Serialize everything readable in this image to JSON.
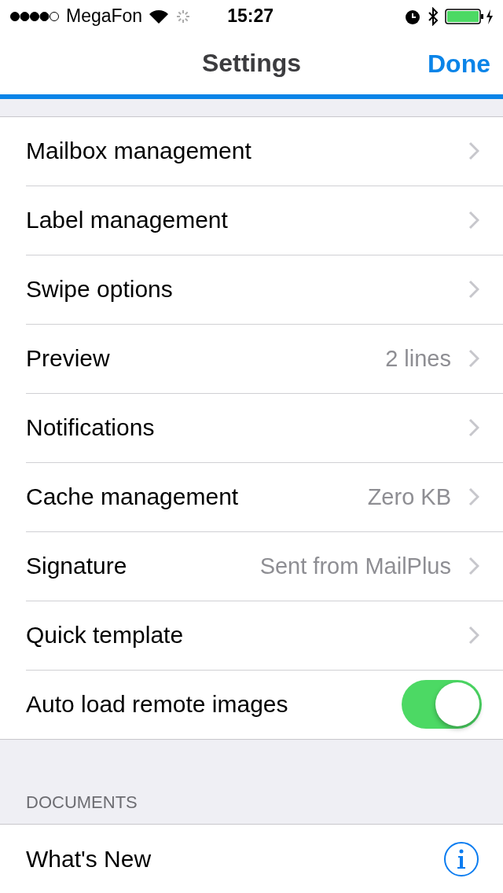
{
  "status_bar": {
    "carrier": "MegaFon",
    "time": "15:27"
  },
  "nav": {
    "title": "Settings",
    "done": "Done"
  },
  "sections": [
    {
      "items": [
        {
          "kind": "link",
          "label": "Mailbox management"
        },
        {
          "kind": "link",
          "label": "Label management"
        },
        {
          "kind": "link",
          "label": "Swipe options"
        },
        {
          "kind": "link",
          "label": "Preview",
          "value": "2 lines"
        },
        {
          "kind": "link",
          "label": "Notifications"
        },
        {
          "kind": "link",
          "label": "Cache management",
          "value": "Zero KB"
        },
        {
          "kind": "link",
          "label": "Signature",
          "value": "Sent from MailPlus"
        },
        {
          "kind": "link",
          "label": "Quick template"
        },
        {
          "kind": "switch",
          "label": "Auto load remote images",
          "on": true
        }
      ]
    },
    {
      "header": "DOCUMENTS",
      "items": [
        {
          "kind": "info",
          "label": "What's New"
        }
      ]
    }
  ]
}
